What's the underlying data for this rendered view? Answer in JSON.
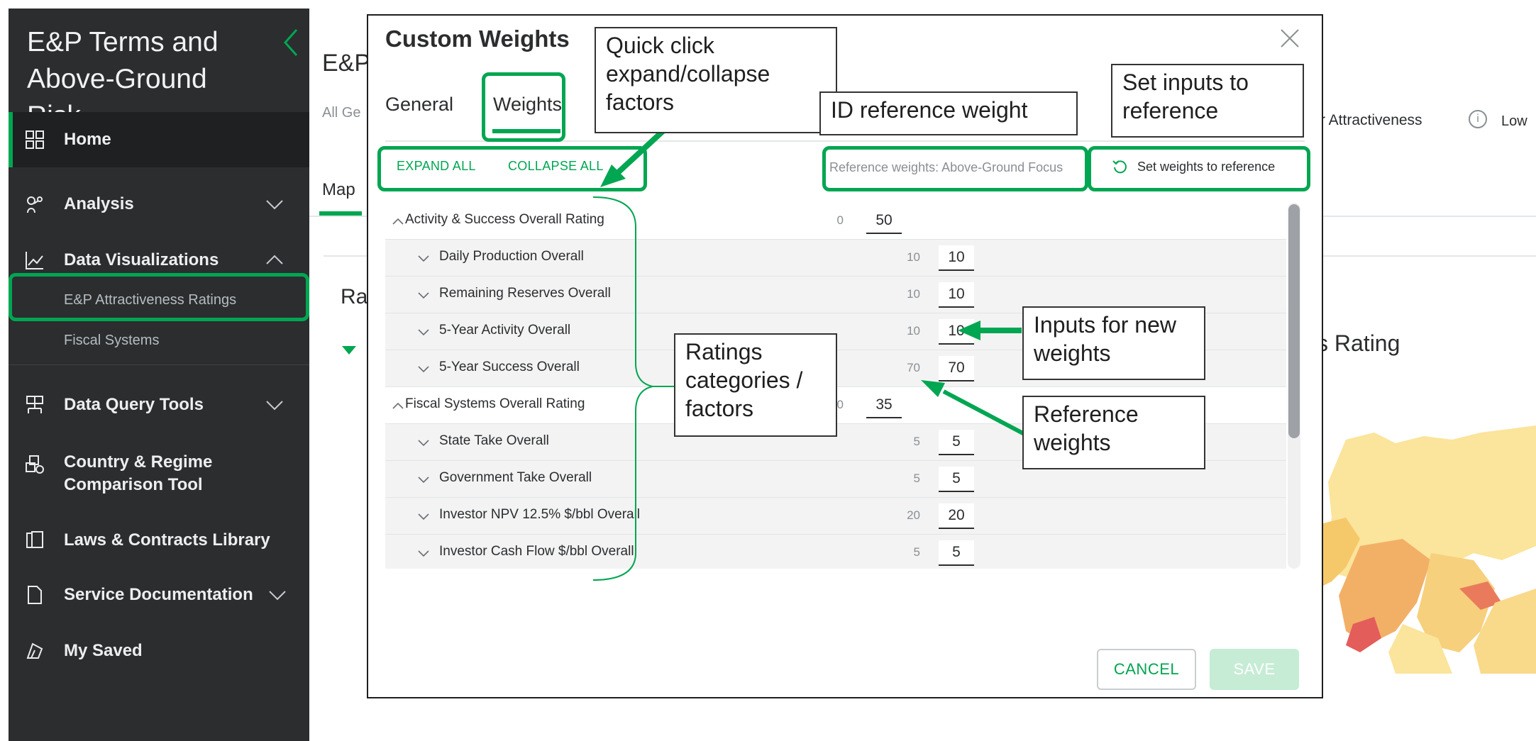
{
  "sidebar": {
    "title": "E&P Terms and Above-Ground Risk",
    "items": [
      {
        "label": "Home",
        "icon": "grid-icon"
      },
      {
        "label": "Analysis",
        "icon": "analysis-icon"
      },
      {
        "label": "Data Visualizations",
        "icon": "line-chart-icon"
      },
      {
        "label": "Data Query Tools",
        "icon": "query-icon"
      },
      {
        "label": "Country & Regime Comparison Tool",
        "icon": "compare-icon"
      },
      {
        "label": "Laws & Contracts Library",
        "icon": "library-icon"
      },
      {
        "label": "Service Documentation",
        "icon": "document-icon"
      },
      {
        "label": "My Saved",
        "icon": "saved-icon"
      }
    ],
    "subitems": [
      {
        "label": "E&P Attractiveness Ratings"
      },
      {
        "label": "Fiscal Systems"
      }
    ]
  },
  "background": {
    "title": "E&P",
    "geo": "All Ge",
    "tab_map": "Map",
    "card_title": "Ra",
    "attractiveness_label": "r Attractiveness",
    "info": "i",
    "low": "Low",
    "rating_title": "s Rating"
  },
  "modal": {
    "title": "Custom Weights",
    "tabs": [
      "General",
      "Weights"
    ],
    "expand_all": "EXPAND ALL",
    "collapse_all": "COLLAPSE ALL",
    "reference_label": "Reference weights: Above-Ground Focus",
    "set_weights": "Set weights to reference",
    "rows": [
      {
        "name": "Activity & Success Overall Rating",
        "ref": "0",
        "value": "50"
      },
      {
        "name": "Daily Production Overall",
        "ref": "10",
        "value": "10"
      },
      {
        "name": "Remaining Reserves Overall",
        "ref": "10",
        "value": "10"
      },
      {
        "name": "5-Year Activity Overall",
        "ref": "10",
        "value": "10"
      },
      {
        "name": "5-Year Success Overall",
        "ref": "70",
        "value": "70"
      },
      {
        "name": "Fiscal Systems Overall Rating",
        "ref": "0",
        "value": "35"
      },
      {
        "name": "State Take Overall",
        "ref": "5",
        "value": "5"
      },
      {
        "name": "Government Take Overall",
        "ref": "5",
        "value": "5"
      },
      {
        "name": "Investor NPV 12.5% $/bbl Overall",
        "ref": "20",
        "value": "20"
      },
      {
        "name": "Investor Cash Flow $/bbl Overall",
        "ref": "5",
        "value": "5"
      }
    ],
    "cancel": "CANCEL",
    "save": "SAVE"
  },
  "annotations": {
    "quick_click": "Quick click expand/collapse factors",
    "id_reference": "ID reference weight",
    "set_inputs": "Set inputs to reference",
    "inputs_new": "Inputs for new weights",
    "ratings_categories": "Ratings categories / factors",
    "reference_weights": "Reference weights"
  },
  "colors": {
    "accent": "#00a651",
    "sidebar": "#2b2d2f",
    "save_disabled": "#c6ecd5"
  }
}
